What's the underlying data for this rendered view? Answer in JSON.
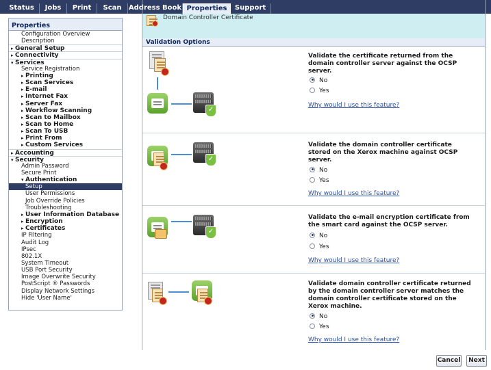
{
  "tabs": [
    {
      "label": "Status"
    },
    {
      "label": "Jobs"
    },
    {
      "label": "Print"
    },
    {
      "label": "Scan"
    },
    {
      "label": "Address Book"
    },
    {
      "label": "Properties"
    },
    {
      "label": "Support"
    }
  ],
  "active_tab": "Properties",
  "sidebar": {
    "title": "Properties",
    "items": [
      {
        "label": "Configuration Overview"
      },
      {
        "label": "Description"
      },
      {
        "label": "General Setup"
      },
      {
        "label": "Connectivity"
      },
      {
        "label": "Services"
      },
      {
        "label": "Service Registration"
      },
      {
        "label": "Printing"
      },
      {
        "label": "Scan Services"
      },
      {
        "label": "E-mail"
      },
      {
        "label": "Internet Fax"
      },
      {
        "label": "Server Fax"
      },
      {
        "label": "Workflow Scanning"
      },
      {
        "label": "Scan to Mailbox"
      },
      {
        "label": "Scan to Home"
      },
      {
        "label": "Scan To USB"
      },
      {
        "label": "Print From"
      },
      {
        "label": "Custom Services"
      },
      {
        "label": "Accounting"
      },
      {
        "label": "Security"
      },
      {
        "label": "Admin Password"
      },
      {
        "label": "Secure Print"
      },
      {
        "label": "Authentication"
      },
      {
        "label": "Setup"
      },
      {
        "label": "User Permissions"
      },
      {
        "label": "Job Override Policies"
      },
      {
        "label": "Troubleshooting"
      },
      {
        "label": "User Information Database"
      },
      {
        "label": "Encryption"
      },
      {
        "label": "Certificates"
      },
      {
        "label": "IP Filtering"
      },
      {
        "label": "Audit Log"
      },
      {
        "label": "IPsec"
      },
      {
        "label": "802.1X"
      },
      {
        "label": "System Timeout"
      },
      {
        "label": "USB Port Security"
      },
      {
        "label": "Image Overwrite Security"
      },
      {
        "label": "PostScript ® Passwords"
      },
      {
        "label": "Display Network Settings"
      },
      {
        "label": "Hide 'User Name'"
      }
    ]
  },
  "banner": {
    "text": "Domain Controller Certificate"
  },
  "validation": {
    "heading": "Validation Options",
    "options": [
      {
        "question": "Validate the certificate returned from the domain controller server against the OCSP server.",
        "no_label": "No",
        "yes_label": "Yes",
        "selected": "No",
        "help_link": "Why would I use this feature?"
      },
      {
        "question": "Validate the domain controller certificate stored on the Xerox machine against OCSP server.",
        "no_label": "No",
        "yes_label": "Yes",
        "selected": "No",
        "help_link": "Why would I use this feature?"
      },
      {
        "question": "Validate the e-mail encryption certificate from the smart card against the OCSP server.",
        "no_label": "No",
        "yes_label": "Yes",
        "selected": "No",
        "help_link": "Why would I use this feature?"
      },
      {
        "question": "Validate domain controller certificate returned by the domain controller server matches the domain controller certificate stored on the Xerox machine.",
        "no_label": "No",
        "yes_label": "Yes",
        "selected": "No",
        "help_link": "Why would I use this feature?"
      }
    ]
  },
  "buttons": {
    "cancel": "Cancel",
    "next": "Next"
  },
  "colors": {
    "nav_bar": "#2f3c63",
    "banner": "#cfeef2",
    "link": "#2a4ea8",
    "accent_green": "#79c043"
  }
}
